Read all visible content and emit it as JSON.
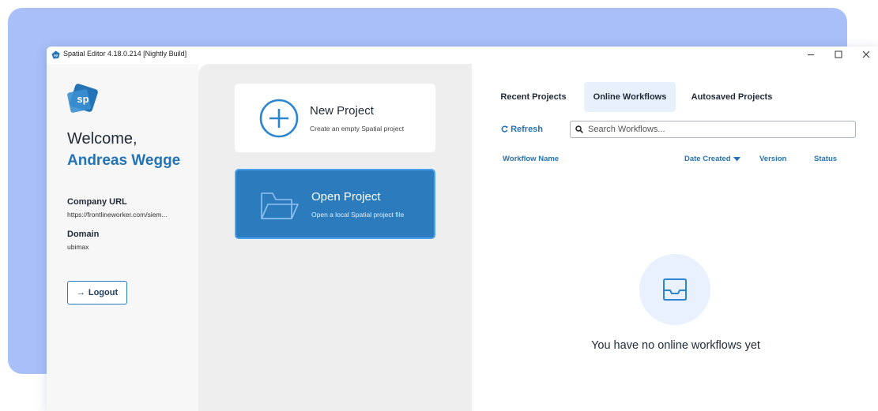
{
  "window": {
    "title": "Spatial Editor 4.18.0.214 [Nightly Build]",
    "minimize_icon": "minimize-icon",
    "maximize_icon": "maximize-icon",
    "close_icon": "close-icon"
  },
  "sidebar": {
    "logo_text": "sp",
    "welcome": "Welcome,",
    "user_name": "Andreas Wegge",
    "company_url_label": "Company URL",
    "company_url_value": "https://frontlineworker.com/siem...",
    "domain_label": "Domain",
    "domain_value": "ubimax",
    "logout_arrow": "→",
    "logout_label": "Logout"
  },
  "actions": {
    "new_project": {
      "title": "New Project",
      "subtitle": "Create an empty Spatial project",
      "icon": "plus-circle-icon"
    },
    "open_project": {
      "title": "Open Project",
      "subtitle": "Open a local Spatial project file",
      "icon": "folder-open-icon"
    }
  },
  "main": {
    "tabs": [
      {
        "label": "Recent Projects",
        "active": false
      },
      {
        "label": "Online Workflows",
        "active": true
      },
      {
        "label": "Autosaved Projects",
        "active": false
      }
    ],
    "refresh_label": "Refresh",
    "search": {
      "placeholder": "Search Workflows...",
      "value": ""
    },
    "columns": {
      "name": "Workflow Name",
      "date": "Date Created",
      "version": "Version",
      "status": "Status"
    },
    "empty_message": "You have no online workflows yet"
  },
  "colors": {
    "accent": "#2473b4",
    "open_card_bg": "#2b7bbd",
    "backdrop": "#a8bff7",
    "active_tab_bg": "#e8f0fb"
  }
}
